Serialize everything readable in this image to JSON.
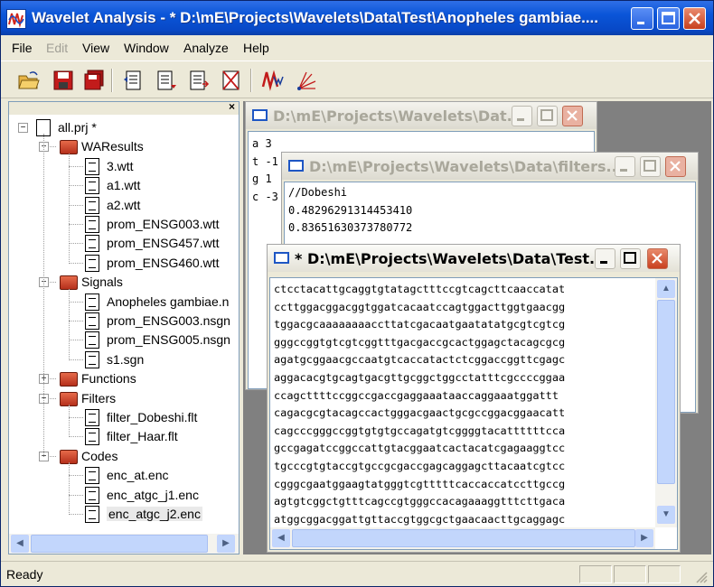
{
  "window": {
    "title": "Wavelet Analysis - * D:\\mE\\Projects\\Wavelets\\Data\\Test\\Anopheles gambiae...."
  },
  "menu": [
    "File",
    "Edit",
    "View",
    "Window",
    "Analyze",
    "Help"
  ],
  "menu_disabled": [
    false,
    true,
    false,
    false,
    false,
    false
  ],
  "toolbar": {
    "buttons": [
      "open-folder-icon",
      "save-icon",
      "save-all-icon",
      "copy-page-icon",
      "list-page-icon",
      "transfer-page-icon",
      "delete-page-icon",
      "wavelet-analyze-icon",
      "spectrum-icon"
    ]
  },
  "tree": {
    "close_glyph": "×",
    "root": "all.prj *",
    "folders": [
      {
        "name": "WAResults",
        "expanded": true,
        "items": [
          "3.wtt",
          "a1.wtt",
          "a2.wtt",
          "prom_ENSG003.wtt",
          "prom_ENSG457.wtt",
          "prom_ENSG460.wtt"
        ]
      },
      {
        "name": "Signals",
        "expanded": true,
        "items": [
          "Anopheles gambiae.n",
          "prom_ENSG003.nsgn",
          "prom_ENSG005.nsgn",
          "s1.sgn"
        ]
      },
      {
        "name": "Functions",
        "expanded": false,
        "items": []
      },
      {
        "name": "Filters",
        "expanded": true,
        "items": [
          "filter_Dobeshi.flt",
          "filter_Haar.flt"
        ]
      },
      {
        "name": "Codes",
        "expanded": true,
        "items": [
          "enc_at.enc",
          "enc_atgc_j1.enc",
          "enc_atgc_j2.enc"
        ]
      }
    ],
    "selected": "enc_atgc_j2.enc"
  },
  "windows": {
    "codes": {
      "title": "D:\\mE\\Projects\\Wavelets\\Dat...",
      "lines": [
        "a 3",
        "t -1",
        "g 1",
        "c -3"
      ]
    },
    "filters": {
      "title": "D:\\mE\\Projects\\Wavelets\\Data\\filters...",
      "lines": [
        "//Dobeshi",
        "0.48296291314453410",
        "0.83651630373780772"
      ]
    },
    "sequence": {
      "title": "* D:\\mE\\Projects\\Wavelets\\Data\\Test...",
      "lines": [
        "ctcctacattgcaggtgtatagctttccgtcagcttcaaccatat",
        "ccttggacggacggtggatcacaatccagtggacttggtgaacgg",
        "tggacgcaaaaaaaaccttatcgacaatgaatatatgcgtcgtcg",
        "gggccggtgtcgtcggtttgacgaccgcactggagctacagcgcg",
        "agatgcggaacgccaatgtcaccatactctcggaccggttcgagc",
        "aggacacgtgcagtgacgttgcggctggcctatttcgccccggaa",
        "ccagcttttccggccgaccgaggaaataaccaggaaatggattt",
        "cagacgcgtacagccactgggacgaactgcgccggacggaacatt",
        "cagcccgggccggtgtgtgccagatgtcggggtacattttttcca",
        "gccgagatccggccattgtacggaatcactacatcgagaaggtcc",
        "tgcccgtgtaccgtgccgcgaccgagcaggagcttacaatcgtcc",
        "cgggcgaatggaagtatgggtcgtttttcaccaccatccttgccg",
        "agtgtcggctgtttcagccgtgggccacagaaaggtttcttgaca",
        "atggcggacggattgttaccgtggcgctgaacaacttgcaggagc"
      ]
    }
  },
  "status": {
    "text": "Ready"
  },
  "glyphs": {
    "up": "▲",
    "down": "▼",
    "left": "◀",
    "right": "▶",
    "expand": "+",
    "collapse": "−"
  },
  "colors": {
    "titlebar": "#0a55d8",
    "accent_close": "#c8401e",
    "folder": "#c8401e",
    "mdi_background": "#808080"
  }
}
